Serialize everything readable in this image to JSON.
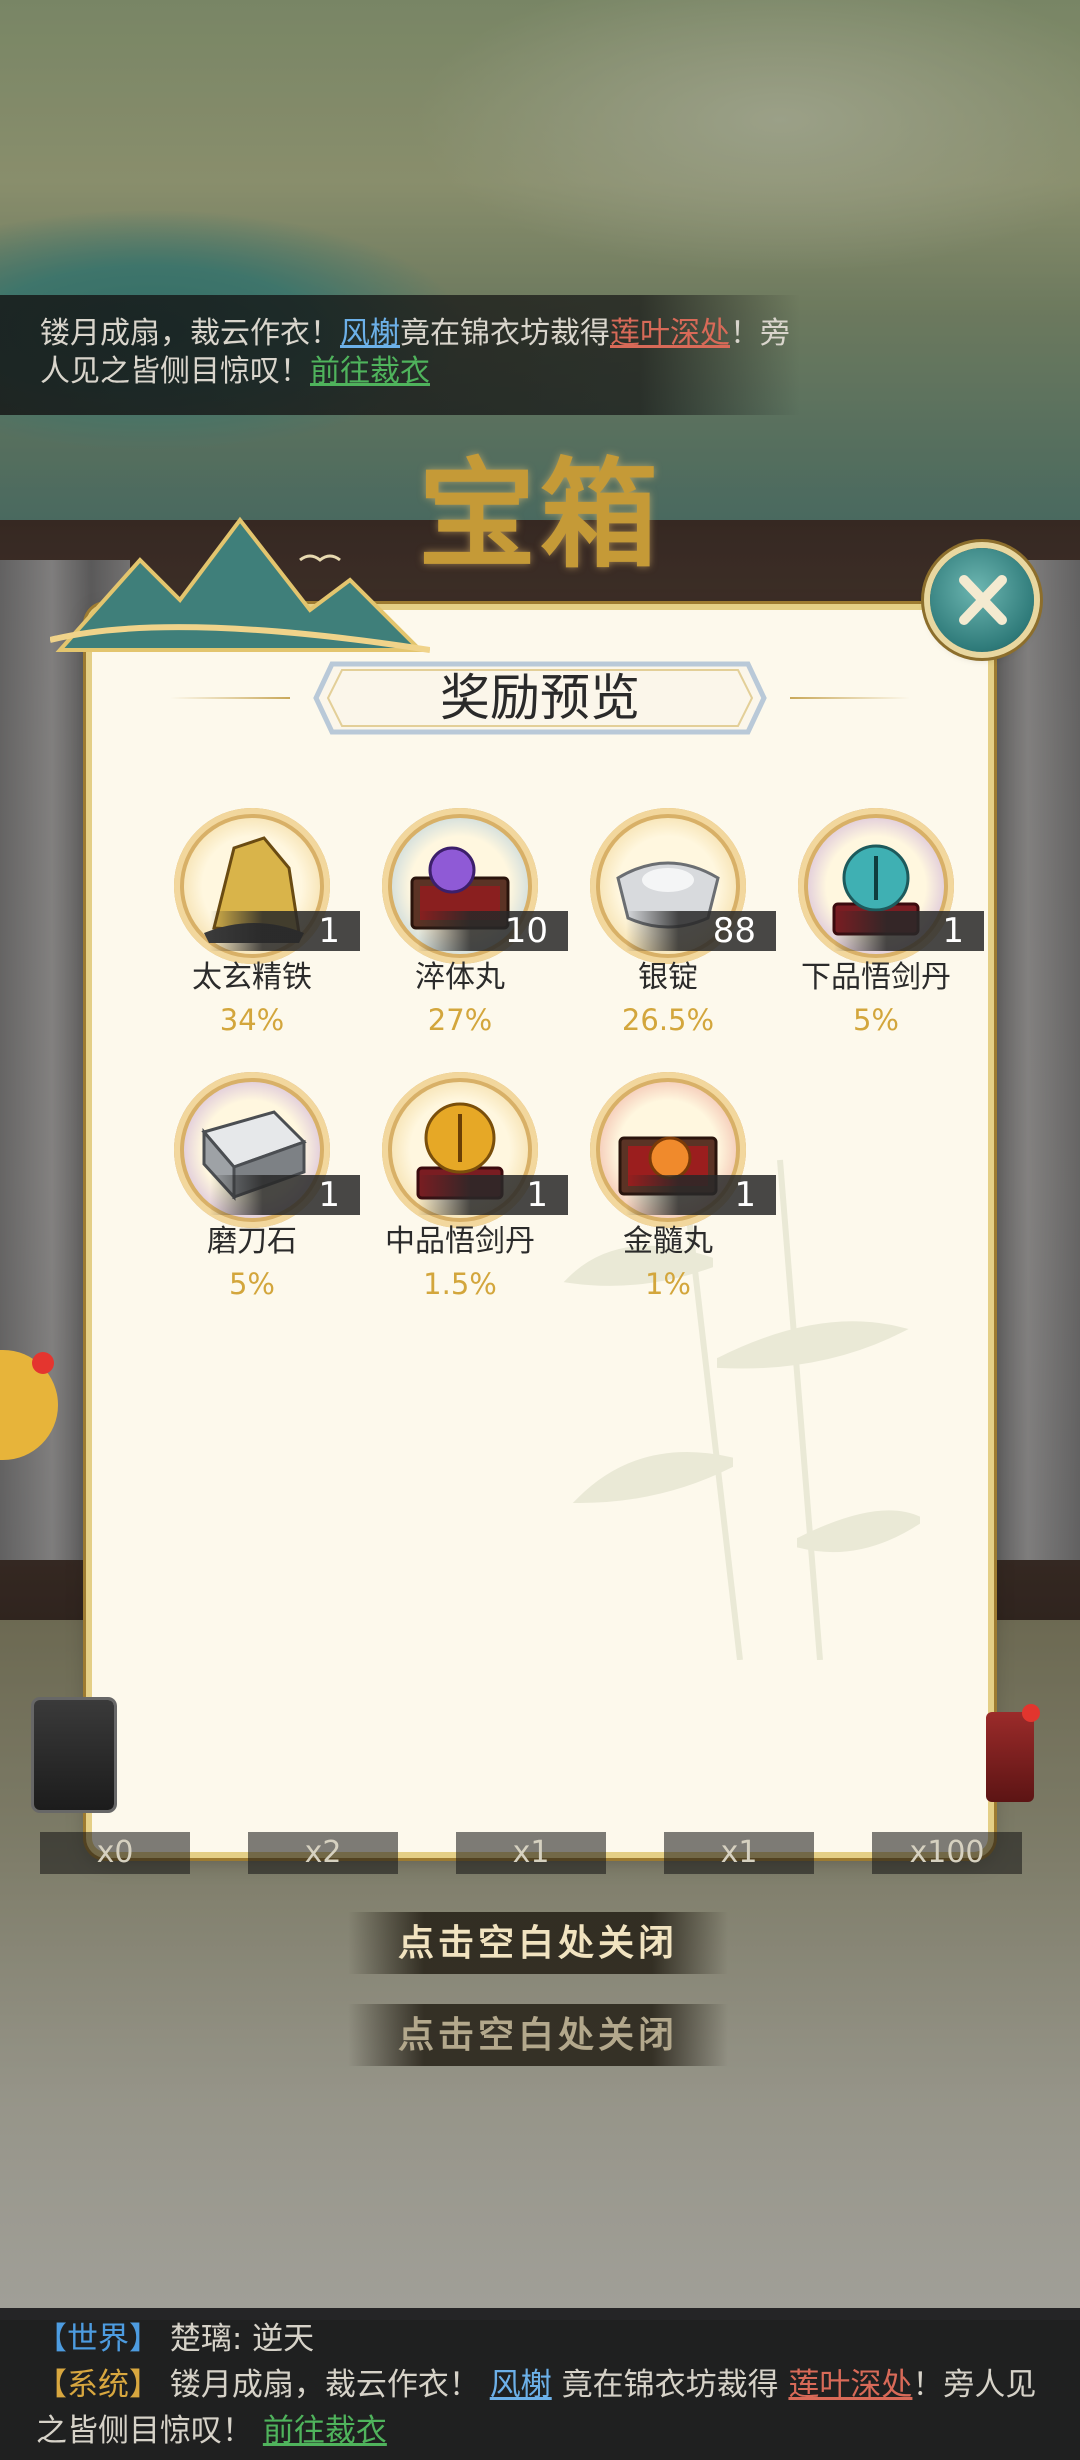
{
  "marquee": {
    "part1": "镂月成扇，裁云作衣！",
    "player": "风榭",
    "part2": "竟在锦衣坊裁得",
    "item": "莲叶深处",
    "part3": "！旁人见之皆侧目惊叹！",
    "link": "前往裁衣"
  },
  "chest_title": "宝箱",
  "modal": {
    "title": "奖励预览",
    "rewards": [
      {
        "name": "太玄精铁",
        "count": "1",
        "chance": "34%",
        "icon": "iron-ore-icon",
        "ring": "#e8c16a"
      },
      {
        "name": "淬体丸",
        "count": "10",
        "chance": "27%",
        "icon": "pill-box-icon",
        "ring": "#7fb0d8"
      },
      {
        "name": "银锭",
        "count": "88",
        "chance": "26.5%",
        "icon": "silver-ingot-icon",
        "ring": "#e8c16a"
      },
      {
        "name": "下品悟剑丹",
        "count": "1",
        "chance": "5%",
        "icon": "sword-pill-icon",
        "ring": "#a77bd2"
      },
      {
        "name": "磨刀石",
        "count": "1",
        "chance": "5%",
        "icon": "whetstone-icon",
        "ring": "#a77bd2"
      },
      {
        "name": "中品悟剑丹",
        "count": "1",
        "chance": "1.5%",
        "icon": "gold-sword-pill-icon",
        "ring": "#e8c16a"
      },
      {
        "name": "金髓丸",
        "count": "1",
        "chance": "1%",
        "icon": "marrow-pill-icon",
        "ring": "#e27b72"
      }
    ]
  },
  "multipliers": [
    "x0",
    "x2",
    "x1",
    "x1",
    "x100"
  ],
  "close_hint": "点击空白处关闭",
  "chat": {
    "world_tag": "【世界】",
    "world_user": "楚璃",
    "world_msg": "逆天",
    "sys_tag": "【系统】",
    "sys_part1": "镂月成扇，裁云作衣！",
    "sys_player": "风榭",
    "sys_part2": "竟在锦衣坊裁得",
    "sys_item": "莲叶深处",
    "sys_part3": "！旁人见之皆侧目惊叹！",
    "sys_link": "前往裁衣"
  }
}
